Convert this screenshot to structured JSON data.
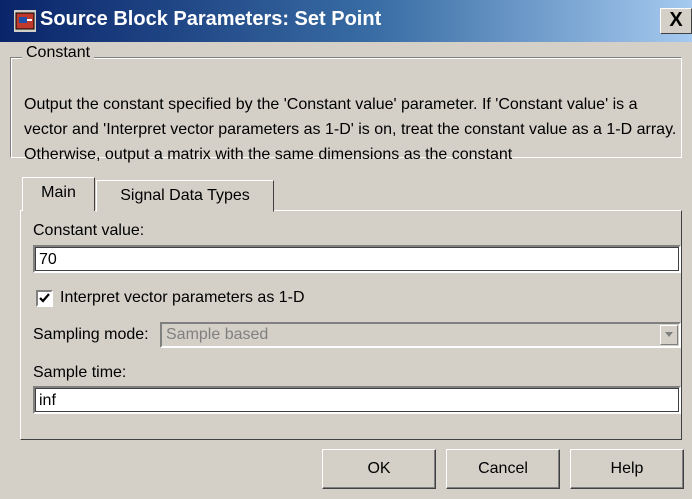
{
  "window": {
    "title": "Source Block Parameters: Set Point",
    "close_glyph": "X",
    "icon": "simulink-block-icon"
  },
  "group": {
    "legend": "Constant",
    "description": "Output the constant specified by the 'Constant value' parameter. If 'Constant value' is a vector and 'Interpret vector parameters as 1-D' is on, treat the constant value as a 1-D array. Otherwise, output a matrix with the same dimensions as the constant"
  },
  "tabs": [
    {
      "label": "Main",
      "active": true
    },
    {
      "label": "Signal Data Types",
      "active": false
    }
  ],
  "main": {
    "constant_value_label": "Constant value:",
    "constant_value": "70",
    "interpret_label": "Interpret vector parameters as 1-D",
    "interpret_checked": true,
    "sampling_mode_label": "Sampling mode:",
    "sampling_mode_value": "Sample based",
    "sample_time_label": "Sample time:",
    "sample_time_value": "inf"
  },
  "buttons": {
    "ok": "OK",
    "cancel": "Cancel",
    "help": "Help"
  },
  "colors": {
    "title_bar_start": "#0a246a",
    "title_bar_end": "#a6caf0",
    "dialog_face": "#d4d0c8",
    "disabled_text": "#808080"
  }
}
